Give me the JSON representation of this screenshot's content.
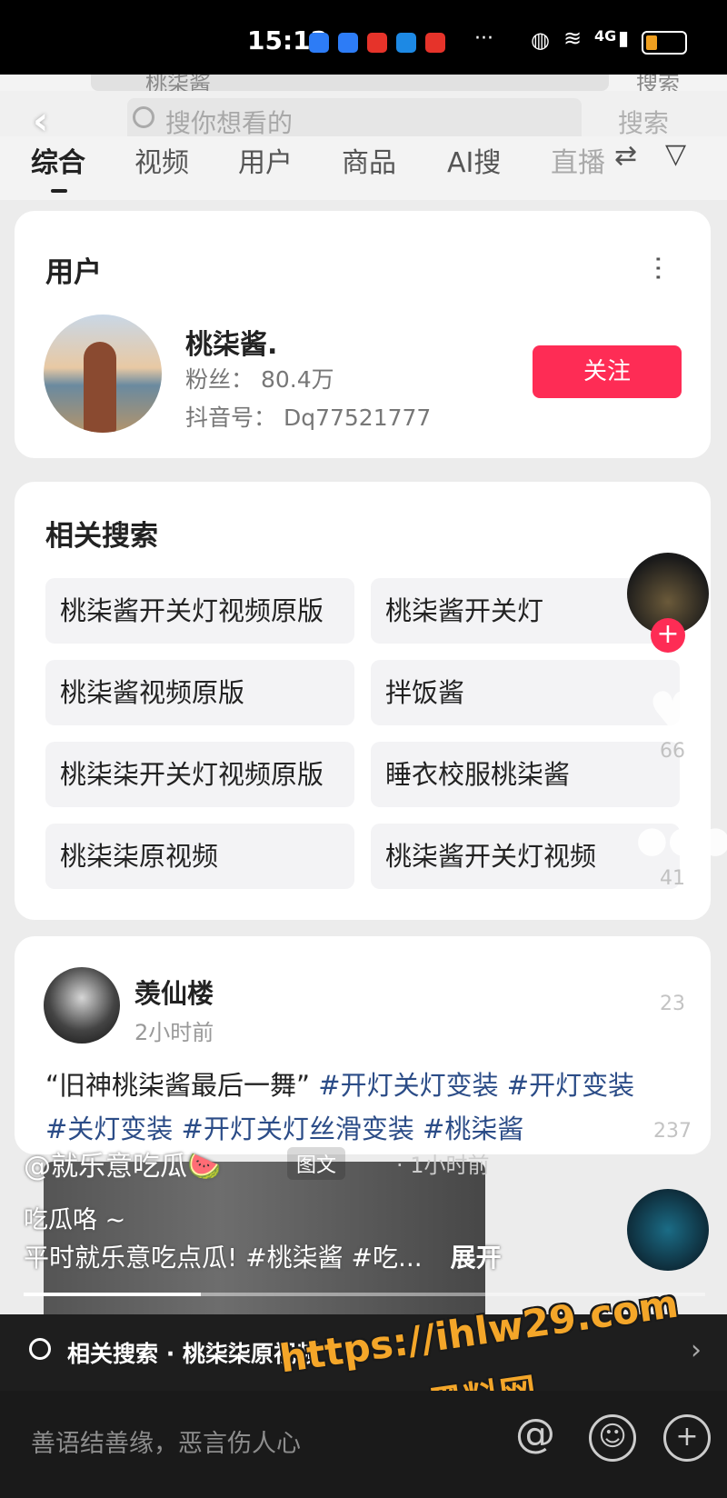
{
  "status_bar": {
    "time": "15:12",
    "more": "···",
    "network": "4G",
    "notification_colors": [
      "#2d7cf6",
      "#2d7cf6",
      "#e6332a",
      "#1d89e4",
      "#e6332a"
    ]
  },
  "background_search": {
    "query": "桃柒酱",
    "submit_label": "搜索"
  },
  "search": {
    "placeholder": "搜你想看的",
    "submit_label": "搜索"
  },
  "tabs": [
    {
      "label": "综合",
      "active": true
    },
    {
      "label": "视频",
      "active": false
    },
    {
      "label": "用户",
      "active": false
    },
    {
      "label": "商品",
      "active": false
    },
    {
      "label": "AI搜",
      "active": false
    },
    {
      "label": "直播",
      "active": false
    }
  ],
  "user_card": {
    "section_title": "用户",
    "name": "桃柒酱.",
    "fans": "粉丝： 80.4万",
    "douyin_id": "抖音号： Dq77521777",
    "follow_label": "关注"
  },
  "related_card": {
    "title": "相关搜索",
    "items": [
      "桃柒酱开关灯视频原版",
      "桃柒酱开关灯",
      "桃柒酱视频原版",
      "拌饭酱",
      "桃柒柒开关灯视频原版",
      "睡衣校服桃柒酱",
      "桃柒柒原视频",
      "桃柒酱开关灯视频"
    ]
  },
  "post": {
    "author": "羡仙楼",
    "time": "2小时前",
    "text_quote": "“旧神桃柒酱最后一舞”",
    "tags_line1": "#开灯关灯变装 #开灯变装",
    "tags_line2": "#关灯变装 #开灯关灯丝滑变装 #桃柒酱"
  },
  "right_rail": {
    "likes": "66",
    "comments": "41",
    "favorites": "23",
    "shares": "237"
  },
  "video_overlay": {
    "author": "@就乐意吃瓜🍉",
    "type_label": "图文",
    "time": "· 1小时前",
    "title": "吃瓜咯 ~",
    "description": "平时就乐意吃点瓜! #桃柒酱 #吃...",
    "expand_label": "展开",
    "progress": 0.26
  },
  "related_bar": {
    "text": "相关搜索 · 桃柒柒原视频"
  },
  "watermark": {
    "url": "https://ihlw29.com",
    "name": "黑料网"
  },
  "comment_bar": {
    "placeholder": "善语结善缘，恶言伤人心",
    "icons": [
      "at-icon",
      "emoji-icon",
      "add-icon"
    ]
  },
  "colors": {
    "accent": "#fe2c55",
    "hashtag": "#2b4c87",
    "watermark": "#f4a629"
  }
}
